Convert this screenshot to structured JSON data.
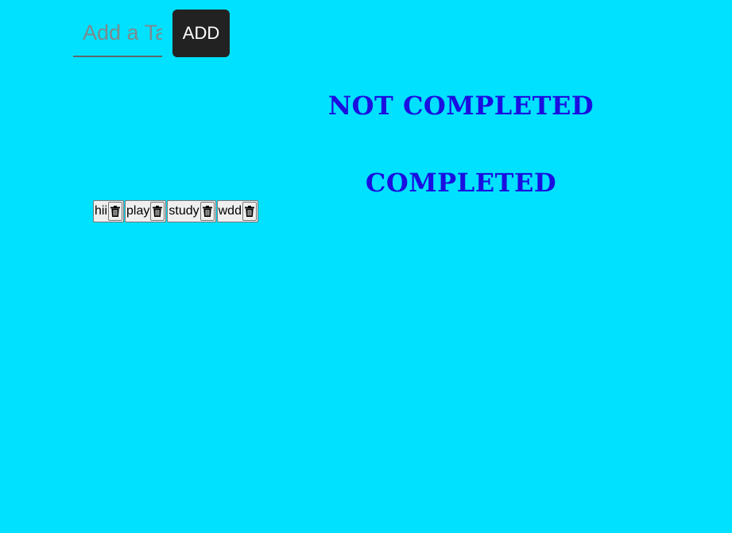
{
  "form": {
    "task_input": {
      "placeholder": "Add a Task",
      "value": ""
    },
    "add_label": "ADD"
  },
  "sections": {
    "not_completed_title": "NOT COMPLETED",
    "completed_title": "COMPLETED"
  },
  "tasks": [
    {
      "label": "hii",
      "delete_icon": "trash-icon"
    },
    {
      "label": "play",
      "delete_icon": "trash-icon"
    },
    {
      "label": "study",
      "delete_icon": "trash-icon"
    },
    {
      "label": "wdd",
      "delete_icon": "trash-icon"
    }
  ],
  "colors": {
    "background": "#00E1FF",
    "heading": "#1a0fe0",
    "button_bg": "#222222",
    "button_text": "#ffffff"
  }
}
